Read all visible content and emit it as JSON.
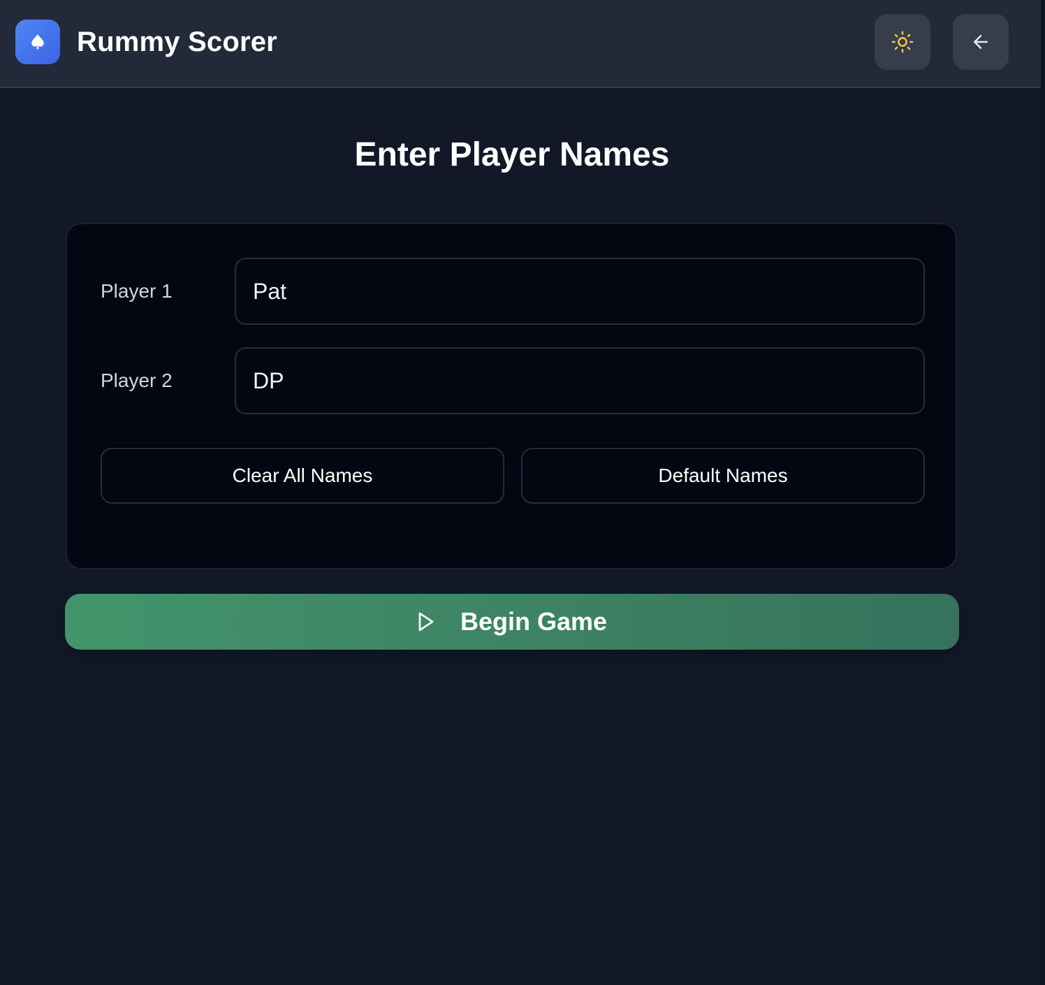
{
  "header": {
    "app_title": "Rummy Scorer",
    "logo_icon": "spade-icon",
    "theme_toggle_icon": "sun-icon",
    "back_icon": "arrow-left-icon"
  },
  "main": {
    "heading": "Enter Player Names",
    "players": [
      {
        "label": "Player 1",
        "value": "Pat"
      },
      {
        "label": "Player 2",
        "value": "DP"
      }
    ],
    "actions": {
      "clear_label": "Clear All Names",
      "default_label": "Default Names"
    },
    "begin": {
      "label": "Begin Game",
      "icon": "play-icon"
    }
  },
  "colors": {
    "background": "#121827",
    "header": "#222938",
    "card": "#030711",
    "brand_blue": "#4f86f7",
    "sun_yellow": "#f6c445",
    "begin_green": "#43946b"
  }
}
